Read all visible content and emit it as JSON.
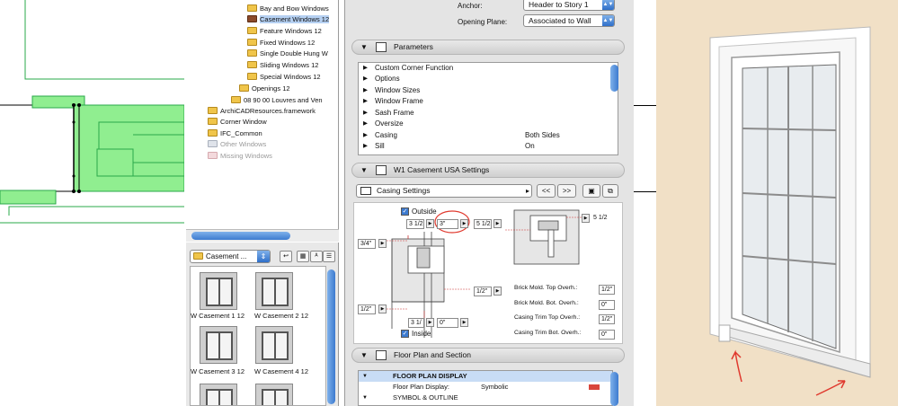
{
  "tree": {
    "items": [
      {
        "label": "Bay and Bow Windows",
        "icon": "folder",
        "indent": 1
      },
      {
        "label": "Casement Windows 12",
        "icon": "folder-brown",
        "indent": 1,
        "selected": true
      },
      {
        "label": "Feature Windows 12",
        "icon": "folder",
        "indent": 1
      },
      {
        "label": "Fixed Windows 12",
        "icon": "folder",
        "indent": 1
      },
      {
        "label": "Single Double Hung W",
        "icon": "folder",
        "indent": 1
      },
      {
        "label": "Sliding Windows 12",
        "icon": "folder",
        "indent": 1
      },
      {
        "label": "Special Windows 12",
        "icon": "folder",
        "indent": 1
      },
      {
        "label": "Openings 12",
        "icon": "folder",
        "indent": 0
      },
      {
        "label": "08 90 00 Louvres and Ven",
        "icon": "folder",
        "indent": 0
      },
      {
        "label": "ArchiCADResources.framework",
        "icon": "folder",
        "indent": -1
      },
      {
        "label": "Corner Window",
        "icon": "folder",
        "indent": -1
      },
      {
        "label": "IFC_Common",
        "icon": "folder",
        "indent": -1
      },
      {
        "label": "Other Windows",
        "icon": "folder-gray",
        "indent": -1,
        "dim": true
      },
      {
        "label": "Missing Windows",
        "icon": "folder-pink",
        "indent": -1,
        "dim": true
      }
    ]
  },
  "library": {
    "folder_select": "Casement ...",
    "thumbnails": [
      {
        "label": "W Casement 1 12"
      },
      {
        "label": "W Casement 2 12"
      },
      {
        "label": "W Casement 3 12"
      },
      {
        "label": "W Casement 4 12"
      }
    ]
  },
  "panel": {
    "anchor_label": "Anchor:",
    "anchor_value": "Header to Story 1",
    "opening_plane_label": "Opening Plane:",
    "opening_plane_value": "Associated to Wall",
    "parameters_title": "Parameters",
    "parameters": [
      {
        "name": "Custom Corner Function",
        "value": ""
      },
      {
        "name": "Options",
        "value": ""
      },
      {
        "name": "Window Sizes",
        "value": ""
      },
      {
        "name": "Window Frame",
        "value": ""
      },
      {
        "name": "Sash Frame",
        "value": ""
      },
      {
        "name": "Oversize",
        "value": ""
      },
      {
        "name": "Casing",
        "value": "Both Sides"
      },
      {
        "name": "Sill",
        "value": "On"
      }
    ],
    "settings_title": "W1 Casement USA Settings",
    "casing_settings": "Casing Settings",
    "prev_label": "<<",
    "next_label": ">>",
    "outside_label": "Outside",
    "inside_label": "Inside",
    "fields": {
      "top_left": "3 1/2",
      "top_mid": "3\"",
      "top_right": "5 1/2",
      "right_side": "5 1/2",
      "left_top": "3/4\"",
      "mid_right": "1/2\"",
      "left_bottom": "1/2\"",
      "bottom_left": "3 1/",
      "bottom_mid": "0\""
    },
    "overhangs": [
      {
        "label": "Brick Mold. Top Overh.:",
        "value": "1/2\""
      },
      {
        "label": "Brick Mold. Bot. Overh.:",
        "value": "0\""
      },
      {
        "label": "Casing Trim Top Overh.:",
        "value": "1/2\""
      },
      {
        "label": "Casing Trim Bot. Overh.:",
        "value": "0\""
      }
    ],
    "floor_plan_title": "Floor Plan and Section",
    "floor_plan_rows": [
      {
        "name": "FLOOR PLAN DISPLAY",
        "value": "",
        "header": true
      },
      {
        "name": "Floor Plan Display:",
        "value": "Symbolic",
        "header": false
      },
      {
        "name": "SYMBOL & OUTLINE",
        "value": "",
        "header": false
      }
    ]
  },
  "colors": {
    "cad_fill": "#90ee90",
    "cad_line": "#2aa84a",
    "accent_blue": "#3d7bd0",
    "annotation_red": "#e03a2f",
    "wall": "#f1e0c6"
  }
}
